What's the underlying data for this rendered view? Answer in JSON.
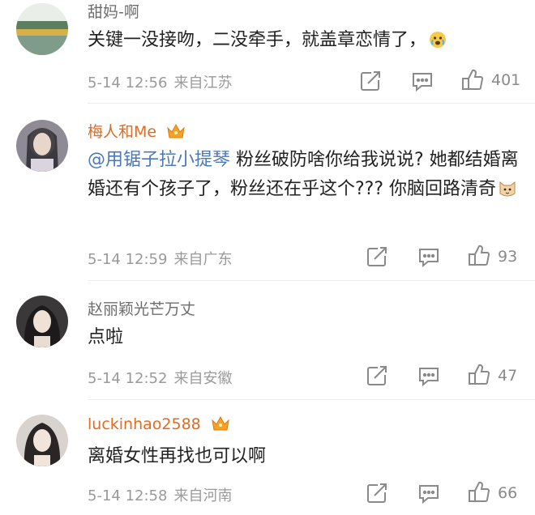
{
  "comments": [
    {
      "username": "甜妈-啊",
      "vip": false,
      "text": "关键一没接吻，二没牵手，就盖章恋情了，",
      "mention": "",
      "emoji": "crying-face-emoji",
      "date": "5-14 12:56",
      "location": "来自江苏",
      "likes": "401"
    },
    {
      "username": "梅人和Me",
      "vip": true,
      "mention": "@用锯子拉小提琴",
      "text": " 粉丝破防啥你给我说说? 她都结婚离婚还有个孩子了，粉丝还在乎这个??? 你脑回路清奇",
      "emoji": "cat-face-emoji",
      "date": "5-14 12:59",
      "location": "来自广东",
      "likes": "93"
    },
    {
      "username": "赵丽颖光芒万丈",
      "vip": false,
      "mention": "",
      "text": "点啦",
      "emoji": "",
      "date": "5-14 12:52",
      "location": "来自安徽",
      "likes": "47"
    },
    {
      "username": "luckinhao2588",
      "vip": true,
      "mention": "",
      "text": "离婚女性再找也可以啊",
      "emoji": "",
      "date": "5-14 12:58",
      "location": "来自河南",
      "likes": "66"
    }
  ],
  "colors": {
    "vip_name": "#e46a1f",
    "mention": "#4b78b8",
    "meta": "#9a9a9a"
  },
  "icons": [
    "share-icon",
    "reply-icon",
    "like-icon",
    "vip-crown-icon"
  ]
}
